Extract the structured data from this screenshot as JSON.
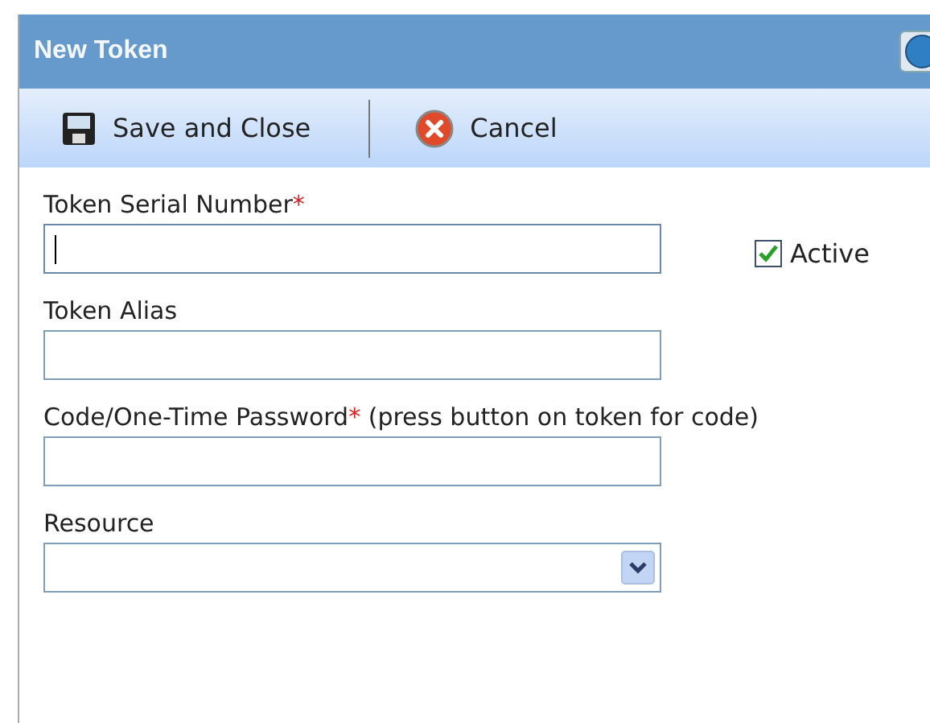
{
  "window": {
    "title": "New Token"
  },
  "toolbar": [
    {
      "label": "Save and Close",
      "kind": "save"
    },
    {
      "label": "Cancel",
      "kind": "cancel"
    }
  ],
  "fields": [
    {
      "label": "Token Serial Number",
      "required_mark": "*",
      "kind": "text",
      "focused": true,
      "checkbox": {
        "label": "Active",
        "checked": true
      }
    },
    {
      "label": "Token Alias",
      "kind": "text",
      "focused": false
    },
    {
      "label": "Code/One-Time Password",
      "required_mark": "*",
      "note": " (press button on token for code)",
      "kind": "text",
      "focused": false
    },
    {
      "label": "Resource",
      "kind": "select",
      "focused": false
    }
  ]
}
